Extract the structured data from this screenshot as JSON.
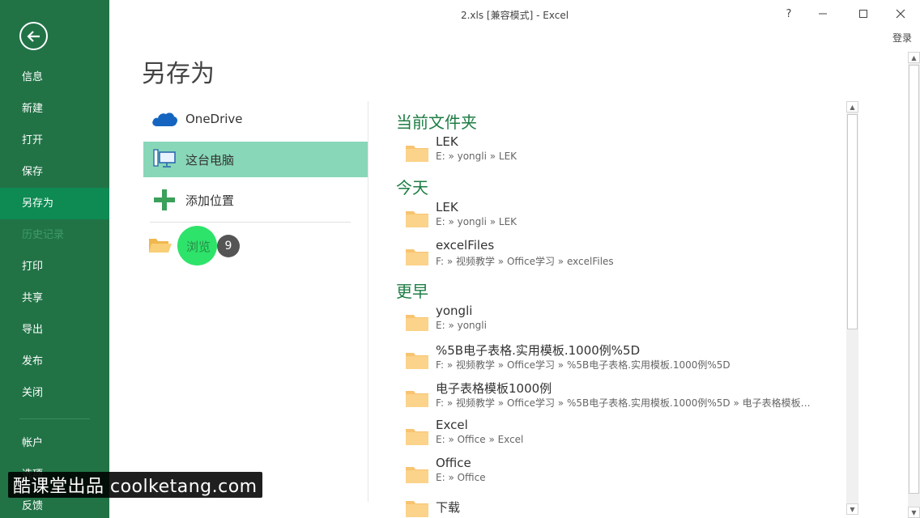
{
  "window": {
    "title": "2.xls  [兼容模式] - Excel",
    "help": "?",
    "login": "登录"
  },
  "sidebar": {
    "items": [
      {
        "label": "信息"
      },
      {
        "label": "新建"
      },
      {
        "label": "打开"
      },
      {
        "label": "保存"
      },
      {
        "label": "另存为",
        "active": true
      },
      {
        "label": "历史记录",
        "disabled": true
      },
      {
        "label": "打印"
      },
      {
        "label": "共享"
      },
      {
        "label": "导出"
      },
      {
        "label": "发布"
      },
      {
        "label": "关闭"
      }
    ],
    "bottom_items": [
      {
        "label": "帐户"
      },
      {
        "label": "选项"
      },
      {
        "label": "反馈"
      }
    ]
  },
  "page": {
    "title": "另存为"
  },
  "places": {
    "onedrive": "OneDrive",
    "this_pc": "这台电脑",
    "add_place": "添加位置",
    "browse": "浏览",
    "browse_badge": "9"
  },
  "folders": {
    "current_header": "当前文件夹",
    "today_header": "今天",
    "earlier_header": "更早",
    "current": [
      {
        "name": "LEK",
        "path": "E: » yongli » LEK"
      }
    ],
    "today": [
      {
        "name": "LEK",
        "path": "E: » yongli » LEK"
      },
      {
        "name": "excelFiles",
        "path": "F: » 视频教学 » Office学习 » excelFiles"
      }
    ],
    "earlier": [
      {
        "name": "yongli",
        "path": "E: » yongli"
      },
      {
        "name": "%5B电子表格.实用模板.1000例%5D",
        "path": "F: » 视频教学 » Office学习 » %5B电子表格.实用模板.1000例%5D"
      },
      {
        "name": "电子表格模板1000例",
        "path": "F: » 视频教学 » Office学习 » %5B电子表格.实用模板.1000例%5D » 电子表格模板10..."
      },
      {
        "name": "Excel",
        "path": "E: » Office » Excel"
      },
      {
        "name": "Office",
        "path": "E: » Office"
      },
      {
        "name": "下载",
        "path": ""
      }
    ]
  },
  "watermark": {
    "text": "酷课堂出品 coolketang.com"
  },
  "colors": {
    "brand_green": "#217346",
    "selected": "#88d7b8",
    "header_green": "#1e7d45",
    "folder": "#f8c471"
  }
}
